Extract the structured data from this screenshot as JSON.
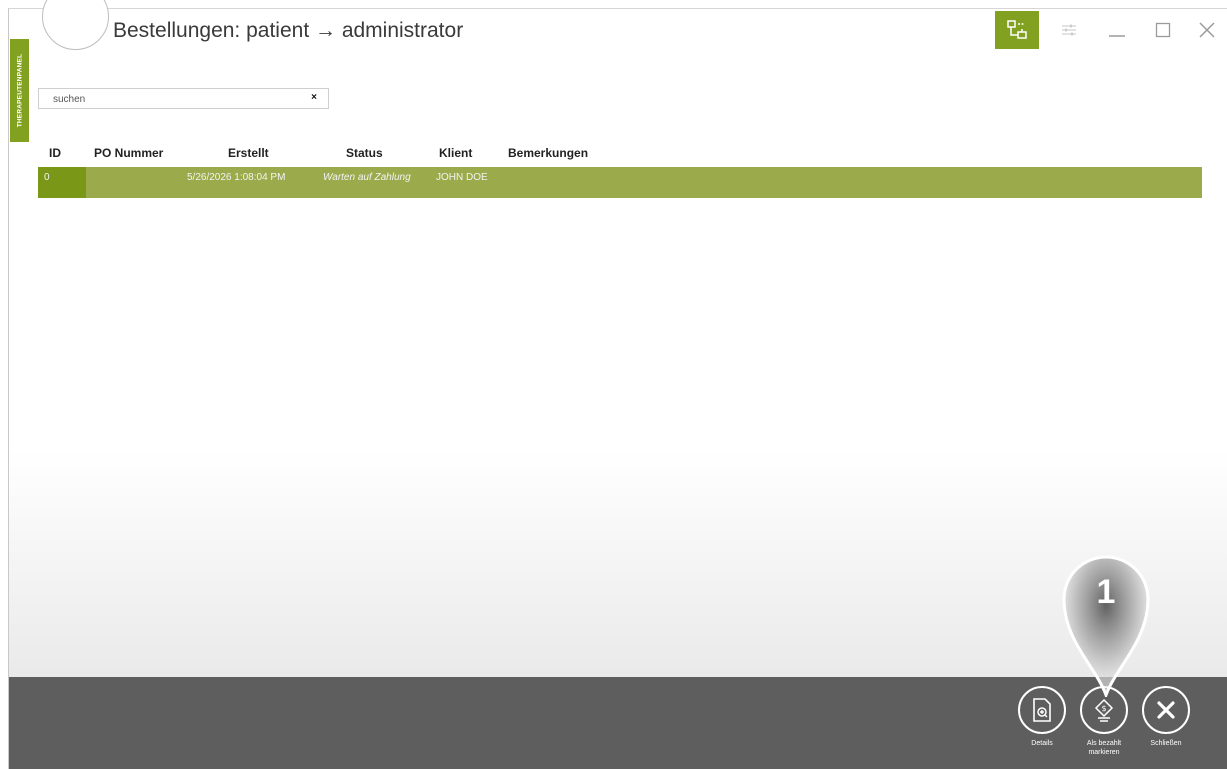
{
  "header": {
    "title": "Bestellungen: patient → administrator",
    "icons": {
      "back": "arrow-left-icon",
      "network": "network-icon",
      "menu": "settings-sliders-icon"
    }
  },
  "side_panel": {
    "label": "THERAPEUTENPANEL"
  },
  "search": {
    "placeholder": "suchen",
    "value": "",
    "clear_symbol": "×"
  },
  "table": {
    "columns": [
      "ID",
      "PO Nummer",
      "Erstellt",
      "Status",
      "Klient",
      "Bemerkungen"
    ],
    "rows": [
      {
        "id": "0",
        "po_number": "",
        "created": "5/26/2026 1:08:04 PM",
        "status": "Warten auf Zahlung",
        "client": "JOHN DOE",
        "remarks": ""
      }
    ]
  },
  "actions": [
    {
      "label": "Details",
      "icon": "document-search-icon"
    },
    {
      "label": "Als bezahlt markieren",
      "icon": "money-hand-icon"
    },
    {
      "label": "Schließen",
      "icon": "close-icon"
    }
  ],
  "callout": {
    "number": "1"
  },
  "colors": {
    "accent": "#82a121",
    "row_selected": "#9bab4b",
    "bottom_bar": "#5e5e5e"
  }
}
